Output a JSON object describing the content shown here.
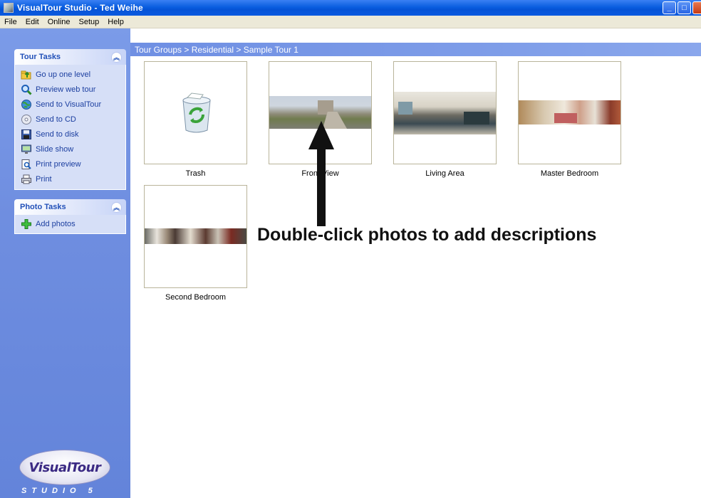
{
  "window": {
    "title": "VisualTour Studio - Ted Weihe",
    "buttons": {
      "minimize": "_",
      "maximize": "□",
      "close": "×"
    }
  },
  "menu": [
    "File",
    "Edit",
    "Online",
    "Setup",
    "Help"
  ],
  "sidebar": {
    "tour_tasks": {
      "title": "Tour Tasks",
      "items": [
        {
          "label": "Go up one level",
          "icon": "folder-up-icon"
        },
        {
          "label": "Preview web tour",
          "icon": "magnifier-icon"
        },
        {
          "label": "Send to VisualTour",
          "icon": "globe-icon"
        },
        {
          "label": "Send to CD",
          "icon": "cd-icon"
        },
        {
          "label": "Send to disk",
          "icon": "floppy-disk-icon"
        },
        {
          "label": "Slide show",
          "icon": "monitor-icon"
        },
        {
          "label": "Print preview",
          "icon": "print-preview-icon"
        },
        {
          "label": "Print",
          "icon": "printer-icon"
        }
      ]
    },
    "photo_tasks": {
      "title": "Photo Tasks",
      "items": [
        {
          "label": "Add photos",
          "icon": "plus-icon"
        }
      ]
    },
    "logo": {
      "text": "VisualTour",
      "subtitle": "STUDIO 5"
    }
  },
  "breadcrumb": "Tour Groups > Residential > Sample Tour 1",
  "thumbnails": [
    {
      "label": "Trash",
      "kind": "recycle-bin"
    },
    {
      "label": "Front View",
      "kind": "photo"
    },
    {
      "label": "Living Area",
      "kind": "photo"
    },
    {
      "label": "Master Bedroom",
      "kind": "photo"
    },
    {
      "label": "Second Bedroom",
      "kind": "photo"
    }
  ],
  "annotation": "Double-click photos to add descriptions",
  "colors": {
    "titlebar": "#0a5ee0",
    "sidebar": "#6f8ee0",
    "task_text": "#1c3fa0",
    "panel_title": "#2150b8"
  }
}
